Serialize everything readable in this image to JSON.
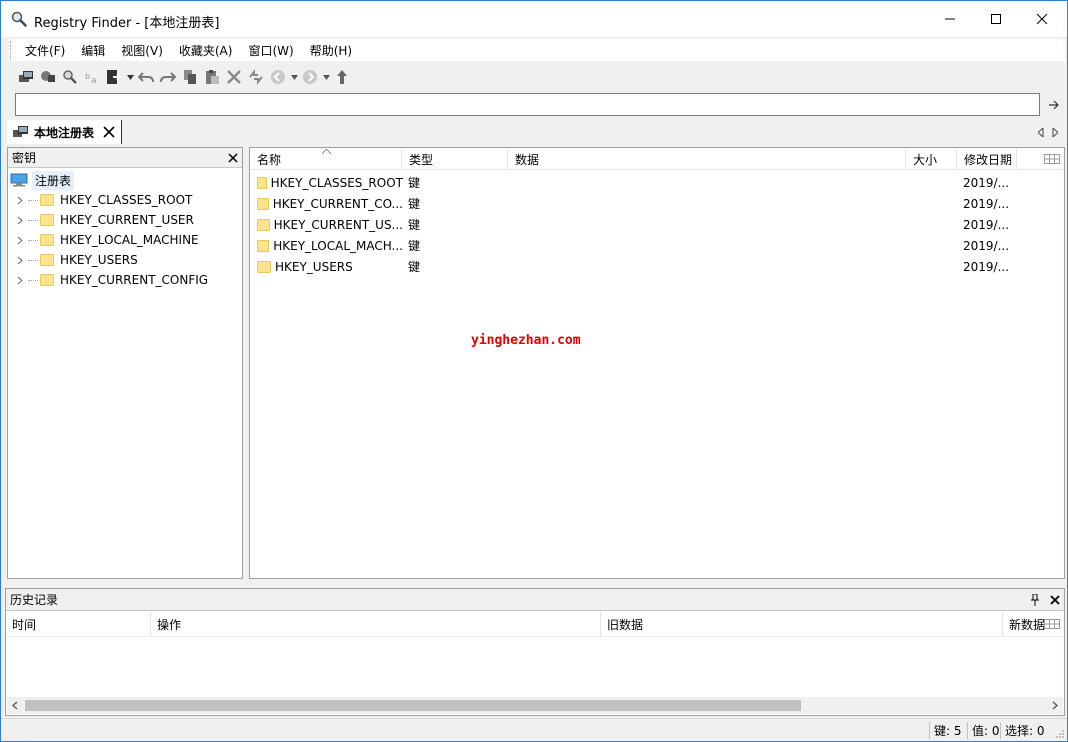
{
  "window": {
    "title": "Registry Finder - [本地注册表]",
    "accent": "#2f7fd6"
  },
  "menu": {
    "items": [
      "文件(F)",
      "编辑",
      "视图(V)",
      "收藏夹(A)",
      "窗口(W)",
      "帮助(H)"
    ]
  },
  "toolbar": {
    "icons": [
      "local-registry-icon",
      "remote-registry-icon",
      "find-icon",
      "replace-icon",
      "export-icon",
      "undo-icon",
      "redo-icon",
      "copy-icon",
      "paste-icon",
      "delete-icon",
      "refresh-icon",
      "back-icon",
      "forward-icon",
      "up-icon"
    ]
  },
  "address": {
    "value": ""
  },
  "tab": {
    "label": "本地注册表"
  },
  "left_pane": {
    "header": "密钥",
    "root": "注册表",
    "keys": [
      "HKEY_CLASSES_ROOT",
      "HKEY_CURRENT_USER",
      "HKEY_LOCAL_MACHINE",
      "HKEY_USERS",
      "HKEY_CURRENT_CONFIG"
    ]
  },
  "right_pane": {
    "columns": [
      "名称",
      "类型",
      "数据",
      "大小",
      "修改日期"
    ],
    "rows": [
      {
        "name": "HKEY_CLASSES_ROOT",
        "type": "键",
        "data": "",
        "size": "",
        "date": "2019/..."
      },
      {
        "name": "HKEY_CURRENT_CO...",
        "type": "键",
        "data": "",
        "size": "",
        "date": "2019/..."
      },
      {
        "name": "HKEY_CURRENT_US...",
        "type": "键",
        "data": "",
        "size": "",
        "date": "2019/..."
      },
      {
        "name": "HKEY_LOCAL_MACH...",
        "type": "键",
        "data": "",
        "size": "",
        "date": "2019/..."
      },
      {
        "name": "HKEY_USERS",
        "type": "键",
        "data": "",
        "size": "",
        "date": "2019/..."
      }
    ]
  },
  "watermark": "yinghezhan.com",
  "history": {
    "title": "历史记录",
    "columns": [
      "时间",
      "操作",
      "旧数据",
      "新数据"
    ]
  },
  "status": {
    "keys": "键: 5",
    "values": "值: 0",
    "selection": "选择: 0"
  }
}
